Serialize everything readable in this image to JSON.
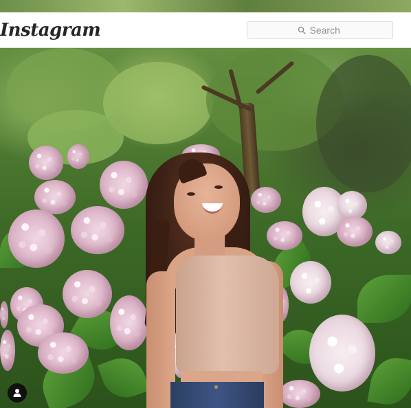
{
  "header": {
    "logo_text": "Instagram",
    "search": {
      "placeholder": "Search",
      "icon": "search-icon"
    }
  },
  "post": {
    "photo_description_icon": "photo",
    "tag_button_icon": "user-icon"
  },
  "colors": {
    "header_bg": "#ffffff",
    "border": "#dbdbdb",
    "text": "#262626",
    "muted": "#8e8e8e"
  }
}
